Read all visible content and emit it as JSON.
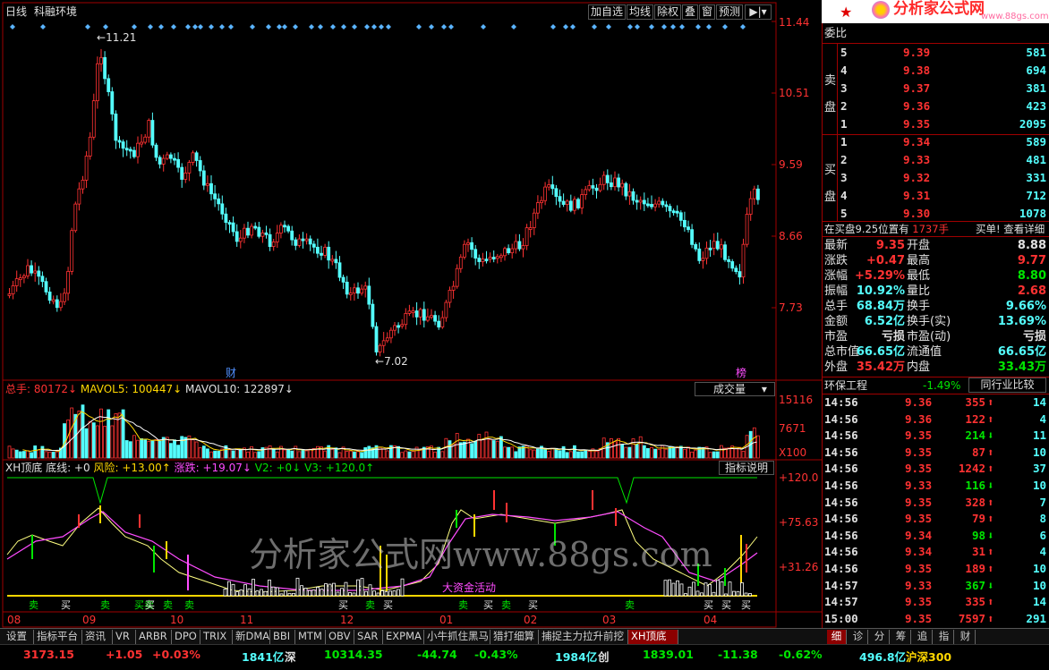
{
  "header": {
    "period": "日线",
    "stock_name": "科融环境"
  },
  "toolbar": [
    "加自选",
    "均线",
    "除权",
    "叠",
    "窗",
    "预测"
  ],
  "logo": {
    "title": "分析家公式网",
    "url": "www.88gs.com"
  },
  "watermark": "分析家公式网www.88gs.com",
  "main_chart": {
    "price_labels": [
      "11.44",
      "10.51",
      "9.59",
      "8.66",
      "7.73"
    ],
    "high_marker": "11.21",
    "low_marker": "7.02",
    "event_labels": [
      "财",
      "榜"
    ]
  },
  "volume_panel": {
    "title_total": "总手: 80172↓",
    "mavol5": "MAVOL5: 100447↓",
    "mavol10": "MAVOL10: 122897↓",
    "dropdown": "成交量",
    "axis": [
      "15116",
      "7671",
      "X100"
    ]
  },
  "indicator_panel": {
    "name": "XH顶底",
    "bottom_line": "底线: +0",
    "risk": "风险: +13.00↑",
    "rise": "涨跌: +19.07↓",
    "v2": "V2: +0↓",
    "v3": "V3: +120.0↑",
    "help_button": "指标说明",
    "axis": [
      "+120.0",
      "+75.63",
      "+31.26"
    ],
    "annotation": "大资金活动",
    "signals": [
      "卖",
      "买",
      "卖",
      "买卖",
      "买",
      "卖",
      "卖",
      "买",
      "卖",
      "买",
      "卖",
      "买",
      "卖",
      "买",
      "卖",
      "买",
      "买",
      "买"
    ]
  },
  "date_axis": [
    "08",
    "09",
    "10",
    "11",
    "12",
    "01",
    "02",
    "03",
    "04"
  ],
  "order_book": {
    "header": "委比",
    "sell_label": [
      "卖",
      "盘"
    ],
    "buy_label": [
      "买",
      "盘"
    ],
    "sell": [
      {
        "lvl": "5",
        "price": "9.39",
        "vol": "581"
      },
      {
        "lvl": "4",
        "price": "9.38",
        "vol": "694"
      },
      {
        "lvl": "3",
        "price": "9.37",
        "vol": "381"
      },
      {
        "lvl": "2",
        "price": "9.36",
        "vol": "423"
      },
      {
        "lvl": "1",
        "price": "9.35",
        "vol": "2095"
      }
    ],
    "buy": [
      {
        "lvl": "1",
        "price": "9.34",
        "vol": "589"
      },
      {
        "lvl": "2",
        "price": "9.33",
        "vol": "481"
      },
      {
        "lvl": "3",
        "price": "9.32",
        "vol": "331"
      },
      {
        "lvl": "4",
        "price": "9.31",
        "vol": "712"
      },
      {
        "lvl": "5",
        "price": "9.30",
        "vol": "1078"
      }
    ]
  },
  "position_info": {
    "text": "在买盘9.25位置有",
    "volume": "1737手",
    "link": "买单! 查看详细"
  },
  "quote": [
    {
      "l1": "最新",
      "v1": "9.35",
      "l2": "开盘",
      "v2": "8.88"
    },
    {
      "l1": "涨跌",
      "v1": "+0.47",
      "l2": "最高",
      "v2": "9.77"
    },
    {
      "l1": "涨幅",
      "v1": "+5.29%",
      "l2": "最低",
      "v2": "8.80"
    },
    {
      "l1": "振幅",
      "v1": "10.92%",
      "l2": "量比",
      "v2": "2.68"
    },
    {
      "l1": "总手",
      "v1": "68.84万",
      "l2": "换手",
      "v2": "9.66%"
    },
    {
      "l1": "金额",
      "v1": "6.52亿",
      "l2": "换手(实)",
      "v2": "13.69%"
    },
    {
      "l1": "市盈",
      "v1": "亏损",
      "l2": "市盈(动)",
      "v2": "亏损"
    },
    {
      "l1": "总市值",
      "v1": "66.65亿",
      "l2": "流通值",
      "v2": "66.65亿"
    },
    {
      "l1": "外盘",
      "v1": "35.42万",
      "l2": "内盘",
      "v2": "33.43万"
    }
  ],
  "sector": {
    "name": "环保工程",
    "change": "-1.49%",
    "button": "同行业比较"
  },
  "ticks": [
    {
      "t": "14:56",
      "p": "9.36",
      "v": "355",
      "d": "up",
      "n": "14"
    },
    {
      "t": "14:56",
      "p": "9.36",
      "v": "122",
      "d": "up",
      "n": "4"
    },
    {
      "t": "14:56",
      "p": "9.35",
      "v": "214",
      "d": "down",
      "n": "11"
    },
    {
      "t": "14:56",
      "p": "9.35",
      "v": "87",
      "d": "up",
      "n": "10"
    },
    {
      "t": "14:56",
      "p": "9.35",
      "v": "1242",
      "d": "up",
      "n": "37"
    },
    {
      "t": "14:56",
      "p": "9.33",
      "v": "116",
      "d": "down",
      "n": "10"
    },
    {
      "t": "14:56",
      "p": "9.35",
      "v": "328",
      "d": "up",
      "n": "7"
    },
    {
      "t": "14:56",
      "p": "9.35",
      "v": "79",
      "d": "up",
      "n": "8"
    },
    {
      "t": "14:56",
      "p": "9.34",
      "v": "98",
      "d": "down",
      "n": "6"
    },
    {
      "t": "14:56",
      "p": "9.34",
      "v": "31",
      "d": "up",
      "n": "4"
    },
    {
      "t": "14:56",
      "p": "9.35",
      "v": "189",
      "d": "up",
      "n": "10"
    },
    {
      "t": "14:57",
      "p": "9.33",
      "v": "367",
      "d": "down",
      "n": "10"
    },
    {
      "t": "14:57",
      "p": "9.35",
      "v": "335",
      "d": "up",
      "n": "14"
    },
    {
      "t": "15:00",
      "p": "9.35",
      "v": "7597",
      "d": "up",
      "n": "291"
    }
  ],
  "tabs": [
    "设置",
    "指标平台",
    "资讯",
    "VR",
    "ARBR",
    "DPO",
    "TRIX",
    "新DMA",
    "BBI",
    "MTM",
    "OBV",
    "SAR",
    "EXPMA",
    "小牛抓住黑马",
    "猎打细算",
    "捕捉主力拉升前挖",
    "XH顶底"
  ],
  "right_tabs": [
    "细",
    "诊",
    "分",
    "筹",
    "追",
    "指",
    "财"
  ],
  "status": {
    "sh_index": "3173.15",
    "sh_change": "+1.05",
    "sh_pct": "+0.03%",
    "sh_amount": "1841亿",
    "sh_label": "深",
    "sz_index": "10314.35",
    "sz_change": "-44.74",
    "sz_pct": "-0.43%",
    "sz_amount": "1984亿",
    "sz_label": "创",
    "cy_index": "1839.01",
    "cy_change": "-11.38",
    "cy_pct": "-0.62%",
    "hs_amount": "496.8亿",
    "hs_label": "沪深300"
  },
  "colors": {
    "up": "#ff3232",
    "down": "#54ffff",
    "border": "#a00000",
    "bg": "#000000"
  }
}
